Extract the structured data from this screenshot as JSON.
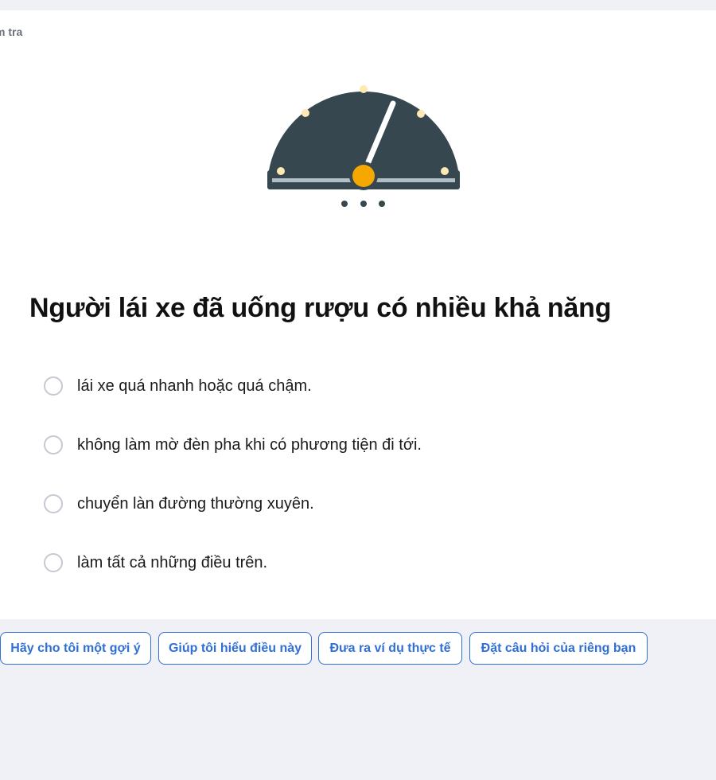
{
  "header": {
    "breadcrumb": "m tra"
  },
  "illustration": {
    "icon": "speedometer-icon",
    "colors": {
      "dial": "#37474f",
      "needle": "#ffffff",
      "hub": "#f5a800",
      "dots": "#fde9b4",
      "rail": "#b0bec5"
    }
  },
  "question": {
    "text": "Người lái xe đã uống rượu có nhiều khả năng",
    "options": [
      {
        "label": "lái xe quá nhanh hoặc quá chậm."
      },
      {
        "label": "không làm mờ đèn pha khi có phương tiện đi tới."
      },
      {
        "label": "chuyển làn đường thường xuyên."
      },
      {
        "label": "làm tất cả những điều trên."
      }
    ]
  },
  "actions": {
    "hint": "Hãy cho tôi một gợi ý",
    "explain": "Giúp tôi hiểu điều này",
    "example": "Đưa ra ví dụ thực tế",
    "ask": "Đặt câu hỏi của riêng bạn"
  },
  "colors": {
    "page_background": "#f0f1f6",
    "card_background": "#ffffff",
    "accent": "#2f6fd6",
    "radio_border": "#c6c8d2"
  }
}
